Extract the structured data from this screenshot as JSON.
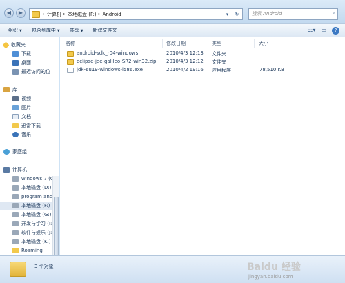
{
  "address_bar": {
    "crumbs": [
      "计算机",
      "本地磁盘 (F:)",
      "Android"
    ]
  },
  "search": {
    "placeholder": "搜索 Android"
  },
  "toolbar": {
    "organize": "组织",
    "include_in_library": "包含到库中",
    "share": "共享",
    "new_folder": "新建文件夹"
  },
  "sidebar": {
    "favorites": {
      "label": "收藏夹",
      "items": [
        "下载",
        "桌面",
        "最近访问的位"
      ]
    },
    "libraries": {
      "label": "库",
      "items": [
        "视频",
        "图片",
        "文档",
        "迅雷下载",
        "音乐"
      ]
    },
    "homegroup": "家庭组",
    "computer": {
      "label": "计算机",
      "items": [
        "windows 7 (C",
        "本地磁盘 (D:)",
        "program and",
        "本地磁盘 (F:)",
        "本地磁盘 (G:)",
        "开发与学习 (I:",
        "软件与娱乐 (J:",
        "本地磁盘 (K:)",
        "Roaming"
      ]
    }
  },
  "columns": {
    "name": "名称",
    "modified": "修改日期",
    "type": "类型",
    "size": "大小"
  },
  "files": [
    {
      "name": "android-sdk_r04-windows",
      "modified": "2010/4/3 12:13",
      "type": "文件夹",
      "size": ""
    },
    {
      "name": "eclipse-jee-galileo-SR2-win32.zip",
      "modified": "2010/4/3 12:12",
      "type": "文件夹",
      "size": ""
    },
    {
      "name": "jdk-6u19-windows-i586.exe",
      "modified": "2010/4/2 19:16",
      "type": "应用程序",
      "size": "78,510 KB"
    }
  ],
  "status": {
    "count": "3 个对象"
  },
  "watermark": {
    "brand": "Baidu 经验",
    "url": "jingyan.baidu.com"
  },
  "colors": {
    "folder": "#f2c94c",
    "accent": "#1e395b",
    "selection": "#dfe8f3"
  },
  "icons": [
    "back-icon",
    "forward-icon",
    "folder-icon",
    "search-icon",
    "view-icon",
    "help-icon",
    "exe-icon"
  ]
}
